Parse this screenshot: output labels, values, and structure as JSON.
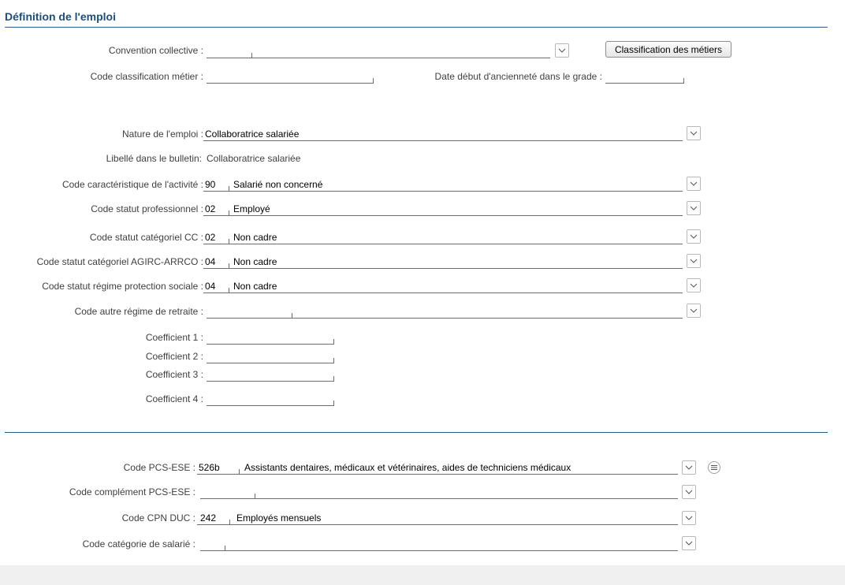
{
  "section": {
    "title": "Définition de l'emploi"
  },
  "convention": {
    "label": "Convention collective :",
    "value": ""
  },
  "classification_button": {
    "label": "Classification des métiers"
  },
  "code_classification": {
    "label": "Code classification métier :",
    "value": ""
  },
  "date_anciennete": {
    "label": "Date début d'ancienneté dans le grade :",
    "value": ""
  },
  "nature_emploi": {
    "label": "Nature de l'emploi :",
    "value": "Collaboratrice salariée"
  },
  "libelle_bulletin": {
    "label": "Libellé dans le bulletin:",
    "value": "Collaboratrice salariée"
  },
  "code_caracteristique": {
    "label": "Code caractéristique de l'activité :",
    "code": "90",
    "text": "Salarié non concerné"
  },
  "code_statut_pro": {
    "label": "Code statut professionnel :",
    "code": "02",
    "text": "Employé"
  },
  "code_statut_cc": {
    "label": "Code statut catégoriel CC :",
    "code": "02",
    "text": "Non cadre"
  },
  "code_statut_agirc": {
    "label": "Code statut catégoriel AGIRC-ARRCO :",
    "code": "04",
    "text": "Non cadre"
  },
  "code_statut_regime": {
    "label": "Code statut régime protection sociale :",
    "code": "04",
    "text": "Non cadre"
  },
  "code_autre_regime": {
    "label": "Code autre régime de retraite :",
    "code": "",
    "text": ""
  },
  "coefficients": [
    {
      "label": "Coefficient 1 :",
      "value": ""
    },
    {
      "label": "Coefficient 2 :",
      "value": ""
    },
    {
      "label": "Coefficient 3 :",
      "value": ""
    },
    {
      "label": "Coefficient 4 :",
      "value": ""
    }
  ],
  "code_pcs": {
    "label": "Code PCS-ESE :",
    "code": "526b",
    "text": "Assistants dentaires, médicaux et vétérinaires, aides de techniciens médicaux"
  },
  "code_complement_pcs": {
    "label": "Code complément PCS-ESE :",
    "code": "",
    "text": ""
  },
  "code_cpn": {
    "label": "Code CPN DUC :",
    "code": "242",
    "text": "Employés mensuels"
  },
  "code_categorie": {
    "label": "Code catégorie de salarié :",
    "code": "",
    "text": ""
  },
  "icons": {
    "dropdown": "chevron-down-icon",
    "list": "list-icon"
  },
  "colors": {
    "title": "#1f4e79",
    "rule": "#2b5f8e"
  }
}
